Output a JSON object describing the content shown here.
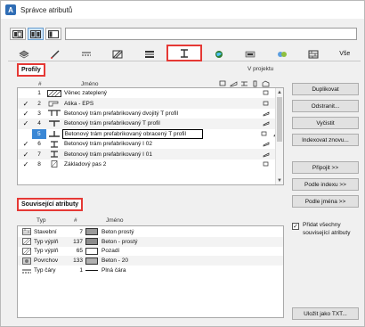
{
  "window": {
    "title": "Správce atributů"
  },
  "search": {
    "value": ""
  },
  "type_tabs": [
    {
      "label": "",
      "icon": "layer-icon"
    },
    {
      "label": "",
      "icon": "pen-icon"
    },
    {
      "label": "",
      "icon": "line-icon"
    },
    {
      "label": "",
      "icon": "fill-icon"
    },
    {
      "label": "",
      "icon": "composite-icon"
    },
    {
      "label": "",
      "icon": "profile-icon",
      "selected": true
    },
    {
      "label": "",
      "icon": "zone-icon"
    },
    {
      "label": "",
      "icon": "mep-icon"
    },
    {
      "label": "",
      "icon": "operation-icon"
    },
    {
      "label": "",
      "icon": "building-material-icon"
    },
    {
      "label": "Vše",
      "icon": ""
    }
  ],
  "profiles": {
    "section_label": "Profily",
    "col_num": "#",
    "col_name": "Jméno",
    "col_project": "V projektu",
    "rows": [
      {
        "check": "",
        "num": "1",
        "name": "Věnec zateplený"
      },
      {
        "check": "✓",
        "num": "2",
        "name": "Atika - EPS"
      },
      {
        "check": "✓",
        "num": "3",
        "name": "Betonový trám prefabrikovaný dvojitý T profil"
      },
      {
        "check": "✓",
        "num": "4",
        "name": "Betonový trám prefabrikovaný T profil"
      },
      {
        "check": "",
        "num": "5",
        "name": "Betonový trám prefabrikovaný obracený T profil",
        "selected": true
      },
      {
        "check": "✓",
        "num": "6",
        "name": "Betonový trám prefabrikovaný I 02"
      },
      {
        "check": "✓",
        "num": "7",
        "name": "Betonový trám prefabrikovaný I 01"
      },
      {
        "check": "✓",
        "num": "8",
        "name": "Základový pas 2"
      }
    ]
  },
  "buttons": {
    "duplicate": "Duplikovat",
    "delete": "Odstranit...",
    "clear": "Vyčistit",
    "index": "Indexovat znovu...",
    "append": "Připojit >>",
    "by_index": "Podle indexu >>",
    "by_name": "Podle jména >>",
    "save_txt": "Uložit jako TXT..."
  },
  "related": {
    "section_label": "Související atributy",
    "col_type": "Typ",
    "col_num": "#",
    "col_name": "Jméno",
    "rows": [
      {
        "icon": "building-material-icon",
        "type": "Stavební",
        "num": "7",
        "name": "Beton prostý",
        "swatch": "#9a9a9a"
      },
      {
        "icon": "fill-icon",
        "type": "Typ výplň",
        "num": "137",
        "name": "Beton - prostý",
        "swatch": "#8c8c8c"
      },
      {
        "icon": "fill-icon",
        "type": "Typ výplň",
        "num": "65",
        "name": "Pozadí",
        "swatch": "#ffffff"
      },
      {
        "icon": "surface-icon",
        "type": "Povrchov",
        "num": "133",
        "name": "Beton - 20",
        "swatch": "#b0b0b0"
      },
      {
        "icon": "line-icon",
        "type": "Typ čáry",
        "num": "1",
        "name": "Plná čára",
        "swatch": "line"
      }
    ],
    "add_all_label": "Přidat všechny související atributy",
    "add_all_checked": true
  }
}
